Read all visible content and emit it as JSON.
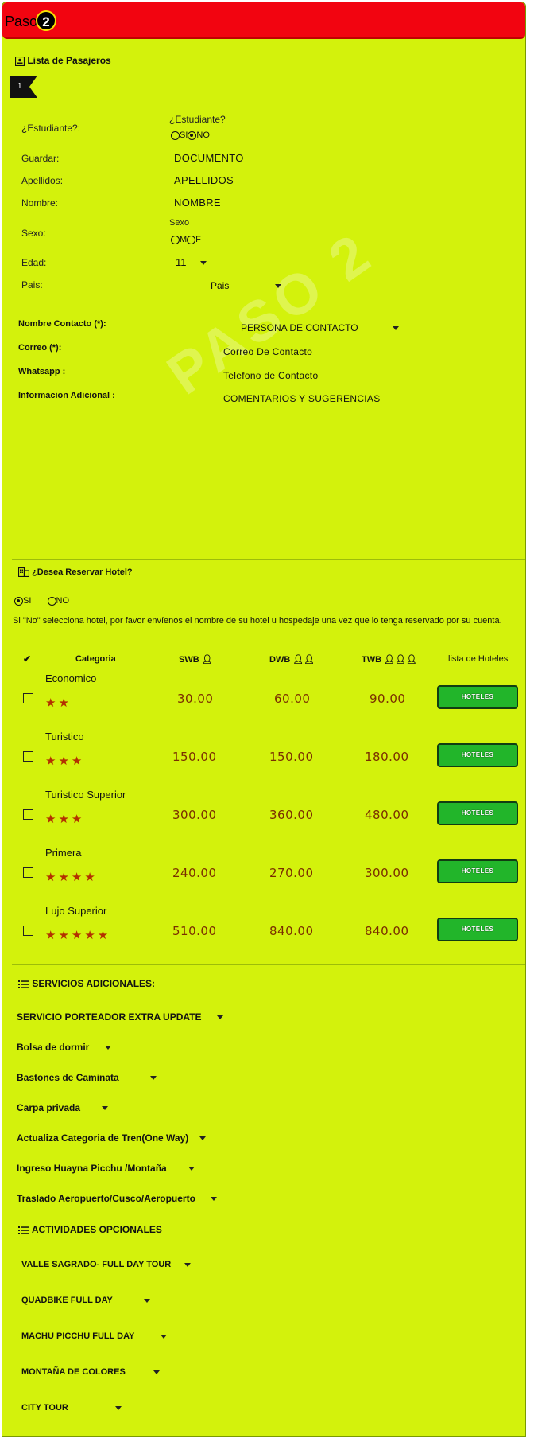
{
  "header": {
    "paso_label": "Paso",
    "paso_number": "2"
  },
  "pasajeros": {
    "title": "Lista de Pasajeros",
    "index": "1",
    "estudiante": {
      "label": "¿Estudiante?:",
      "question": "¿Estudiante?",
      "opt_si": "SI",
      "opt_no": "NO",
      "selected": "NO"
    },
    "guardar": {
      "label": "Guardar:",
      "value": "DOCUMENTO"
    },
    "apellidos": {
      "label": "Apellidos:",
      "value": "APELLIDOS"
    },
    "nombre": {
      "label": "Nombre:",
      "value": "NOMBRE"
    },
    "sexo": {
      "label": "Sexo:",
      "question": "Sexo",
      "opt_m": "M",
      "opt_f": "F"
    },
    "edad": {
      "label": "Edad:",
      "value": "11"
    },
    "pais": {
      "label": "Pais:",
      "value": "Pais"
    },
    "contacto": {
      "label": "Nombre Contacto (*):",
      "value": "PERSONA DE CONTACTO"
    },
    "correo": {
      "label": "Correo (*):",
      "value": "Correo De Contacto"
    },
    "whatsapp": {
      "label": "Whatsapp :",
      "value": "Telefono de Contacto"
    },
    "info": {
      "label": "Informacion Adicional :",
      "value": "COMENTARIOS Y SUGERENCIAS"
    },
    "watermark": "PASO 2"
  },
  "hotel": {
    "title": "¿Desea Reservar Hotel?",
    "opt_si": "SI",
    "opt_no": "NO",
    "selected": "SI",
    "note": "Si \"No\" selecciona hotel, por favor envíenos el nombre de su hotel u hospedaje una vez que lo tenga reservado por su cuenta.",
    "columns": {
      "check": "✔",
      "categoria": "Categoria",
      "swb": "SWB",
      "dwb": "DWB",
      "twb": "TWB",
      "lista": "lista de Hoteles"
    },
    "button_label": "HOTELES",
    "rows": [
      {
        "name": "Economico",
        "stars": "★★",
        "swb": "30.00",
        "dwb": "60.00",
        "twb": "90.00"
      },
      {
        "name": "Turistico",
        "stars": "★★★",
        "swb": "150.00",
        "dwb": "150.00",
        "twb": "180.00"
      },
      {
        "name": "Turistico Superior",
        "stars": "★★★",
        "swb": "300.00",
        "dwb": "360.00",
        "twb": "480.00"
      },
      {
        "name": "Primera",
        "stars": "★★★★",
        "swb": "240.00",
        "dwb": "270.00",
        "twb": "300.00"
      },
      {
        "name": "Lujo Superior",
        "stars": "★★★★★",
        "swb": "510.00",
        "dwb": "840.00",
        "twb": "840.00"
      }
    ]
  },
  "servicios": {
    "title": "SERVICIOS ADICIONALES:",
    "items": [
      "SERVICIO PORTEADOR EXTRA UPDATE",
      "Bolsa de dormir",
      "Bastones de Caminata",
      "Carpa privada",
      "Actualiza Categoria de Tren(One Way)",
      "Ingreso Huayna Picchu /Montaña",
      "Traslado Aeropuerto/Cusco/Aeropuerto"
    ]
  },
  "actividades": {
    "title": "ACTIVIDADES OPCIONALES",
    "items": [
      "VALLE SAGRADO- FULL DAY TOUR",
      "QUADBIKE FULL DAY",
      "MACHU PICCHU FULL DAY",
      "MONTAÑA DE COLORES",
      "CITY TOUR"
    ]
  }
}
